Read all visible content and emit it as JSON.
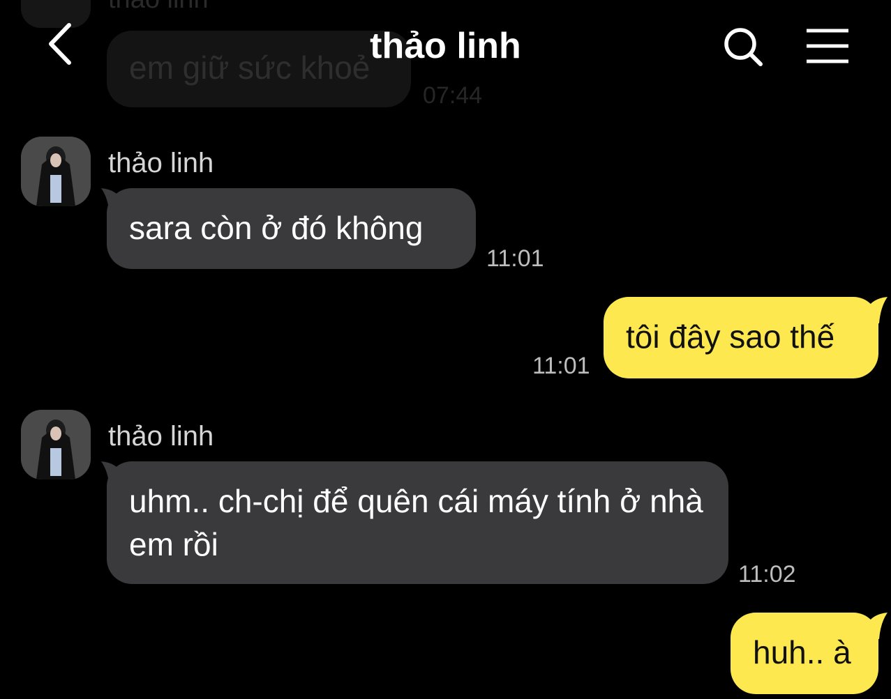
{
  "header": {
    "title": "thảo linh"
  },
  "previous_message": {
    "sender": "thảo linh",
    "text": "em giữ sức khoẻ",
    "time": "07:44"
  },
  "messages": [
    {
      "direction": "incoming",
      "sender": "thảo linh",
      "text": "sara còn ở đó không",
      "time": "11:01"
    },
    {
      "direction": "outgoing",
      "text": "tôi đây sao thế",
      "time": "11:01"
    },
    {
      "direction": "incoming",
      "sender": "thảo linh",
      "text": "uhm.. ch-chị để quên cái máy tính ở nhà em rồi",
      "time": "11:02"
    },
    {
      "direction": "outgoing",
      "text": "huh.. à"
    }
  ],
  "icons": {
    "back": "chevron-left-icon",
    "search": "search-icon",
    "menu": "menu-icon"
  },
  "colors": {
    "background": "#000000",
    "incoming_bubble": "#3a3a3c",
    "outgoing_bubble": "#fde84f"
  }
}
